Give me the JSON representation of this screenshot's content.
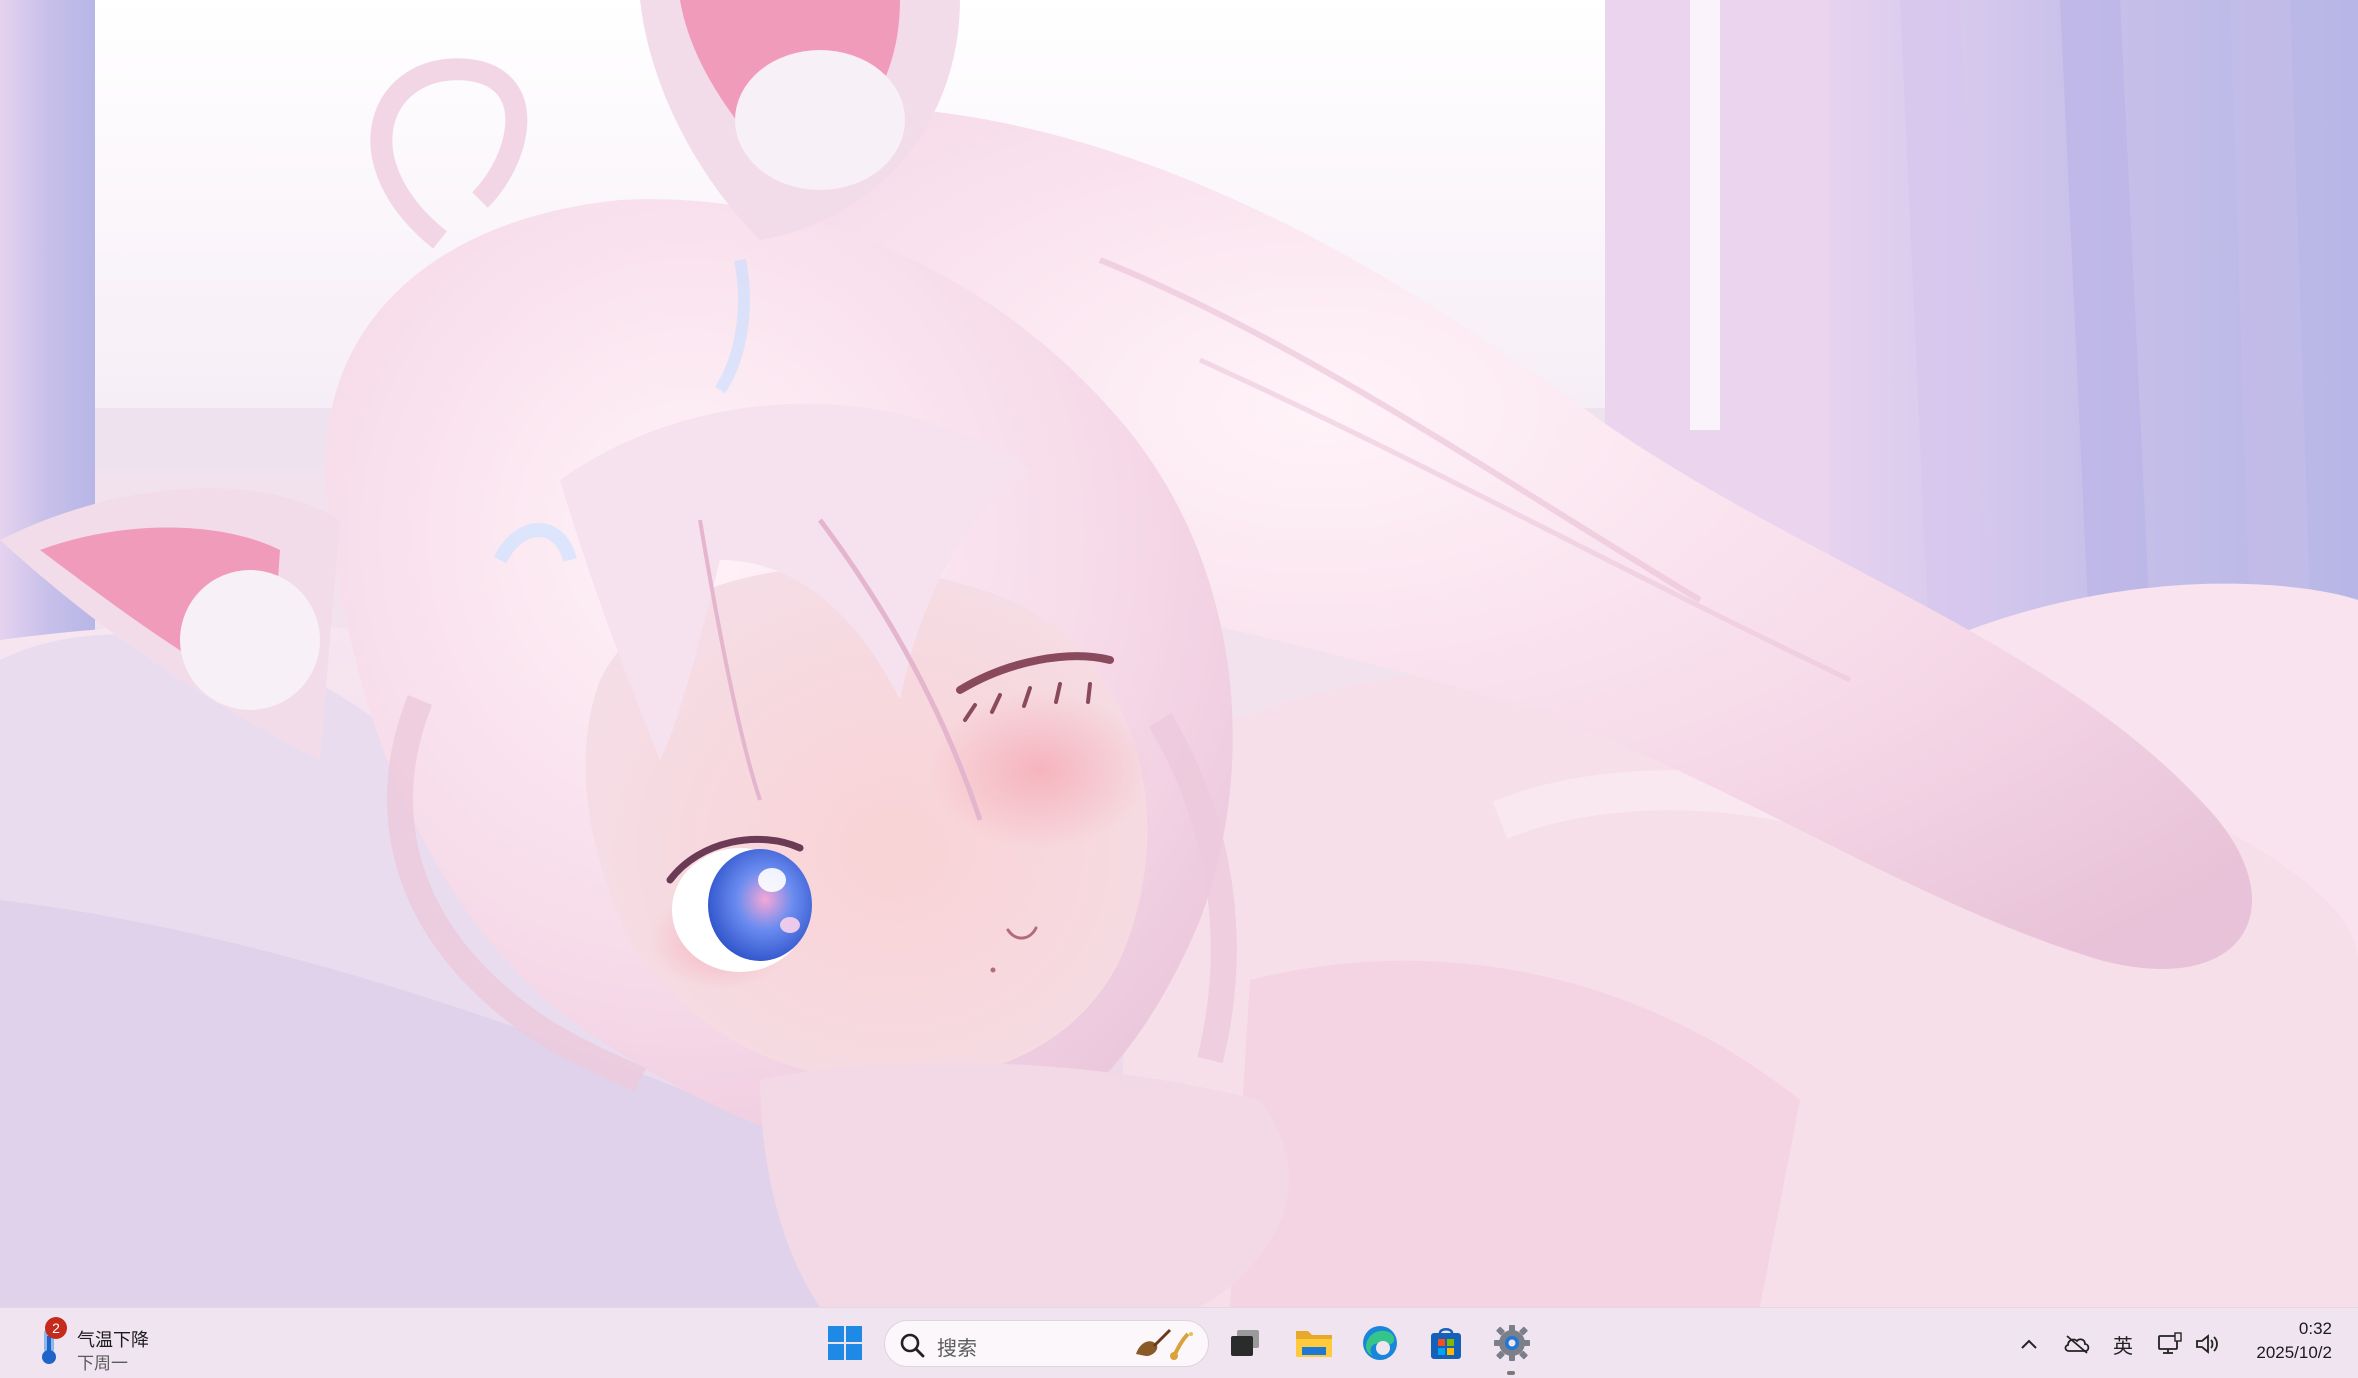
{
  "wallpaper": {
    "subject": "anime-cat-girl-sleeping-on-pillow",
    "palette": {
      "bg_light": "#fbf3fa",
      "pink": "#f4c9dd",
      "lavender": "#c9bfe6",
      "hair": "#f3dce9",
      "eye_blue": "#4a76e0"
    }
  },
  "taskbar": {
    "widget": {
      "badge_count": "2",
      "title": "气温下降",
      "subtitle": "下周一",
      "icon": "thermometer-icon"
    },
    "search": {
      "placeholder": "搜索",
      "icon": "search-icon"
    },
    "pinned_apps": [
      {
        "name": "start",
        "icon": "windows-logo-icon"
      },
      {
        "name": "task-view",
        "icon": "task-view-icon"
      },
      {
        "name": "file-explorer",
        "icon": "folder-icon"
      },
      {
        "name": "edge",
        "icon": "edge-icon"
      },
      {
        "name": "microsoft-store",
        "icon": "store-icon"
      },
      {
        "name": "settings",
        "icon": "gear-icon",
        "running": true
      }
    ],
    "tray": {
      "show_hidden_icon": "chevron-up-icon",
      "onedrive_icon": "cloud-offline-icon",
      "input_method": "英",
      "network_icon": "network-icon",
      "volume_icon": "speaker-icon"
    },
    "clock": {
      "time": "0:32",
      "date": "2025/10/2"
    },
    "colors": {
      "taskbar_bg": "#f1e4f1",
      "badge": "#c42b1c",
      "accent_blue": "#0078d4"
    }
  }
}
